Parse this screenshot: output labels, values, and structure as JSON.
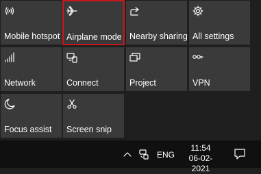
{
  "tiles": [
    {
      "label": "Mobile hotspot",
      "icon": "mobile-hotspot-icon"
    },
    {
      "label": "Airplane mode",
      "icon": "airplane-icon"
    },
    {
      "label": "Nearby sharing",
      "icon": "nearby-sharing-icon"
    },
    {
      "label": "All settings",
      "icon": "gear-icon"
    },
    {
      "label": "Network",
      "icon": "network-icon"
    },
    {
      "label": "Connect",
      "icon": "connect-icon"
    },
    {
      "label": "Project",
      "icon": "project-icon"
    },
    {
      "label": "VPN",
      "icon": "vpn-icon"
    },
    {
      "label": "Focus assist",
      "icon": "moon-icon"
    },
    {
      "label": "Screen snip",
      "icon": "screen-snip-icon"
    }
  ],
  "taskbar": {
    "language": "ENG",
    "time": "11:54",
    "date": "06-02-2021"
  },
  "colors": {
    "tile_bg": "#3a3a3a",
    "panel_bg": "#1f1f1f",
    "taskbar_bg": "#101010",
    "selected_border": "#c8181d"
  }
}
